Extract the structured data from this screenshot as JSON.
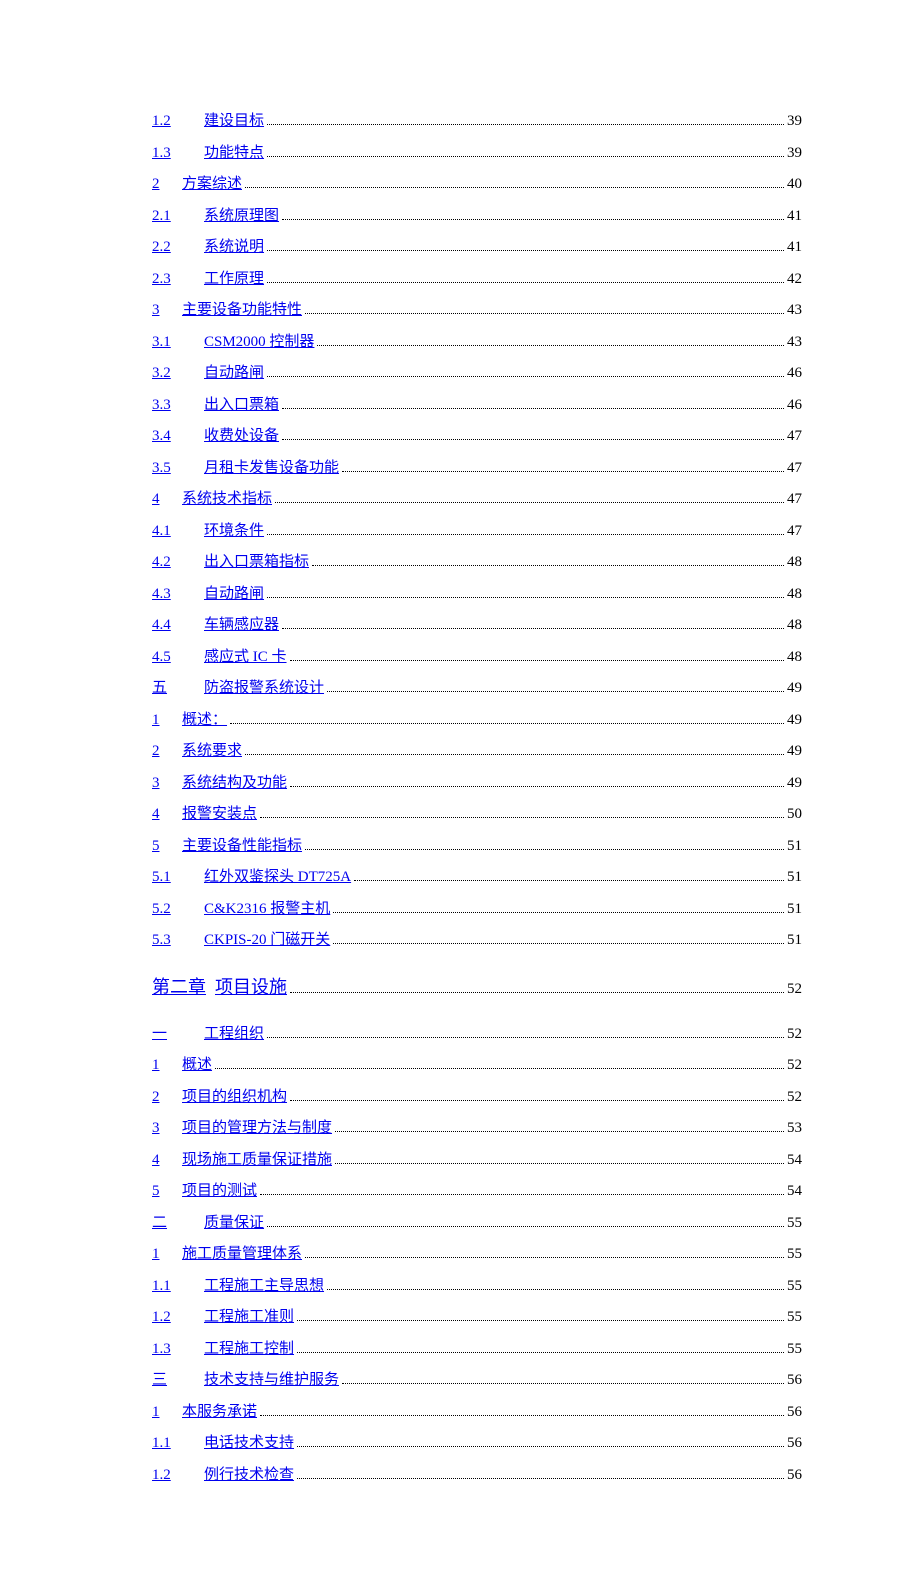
{
  "toc": [
    {
      "type": "item",
      "num": "1.2",
      "numW": 52,
      "title": "建设目标",
      "page": "39"
    },
    {
      "type": "item",
      "num": "1.3",
      "numW": 52,
      "title": "功能特点",
      "page": "39"
    },
    {
      "type": "item",
      "num": "2",
      "numW": 30,
      "title": "方案综述",
      "page": "40"
    },
    {
      "type": "item",
      "num": "2.1",
      "numW": 52,
      "title": "系统原理图",
      "page": "41"
    },
    {
      "type": "item",
      "num": "2.2",
      "numW": 52,
      "title": "系统说明",
      "page": "41"
    },
    {
      "type": "item",
      "num": "2.3",
      "numW": 52,
      "title": "工作原理",
      "page": "42"
    },
    {
      "type": "item",
      "num": "3",
      "numW": 30,
      "title": "主要设备功能特性",
      "page": "43"
    },
    {
      "type": "item",
      "num": "3.1",
      "numW": 52,
      "title": "CSM2000 控制器",
      "page": "43"
    },
    {
      "type": "item",
      "num": "3.2",
      "numW": 52,
      "title": "自动路闸",
      "page": "46"
    },
    {
      "type": "item",
      "num": "3.3",
      "numW": 52,
      "title": "出入口票箱",
      "page": "46"
    },
    {
      "type": "item",
      "num": "3.4",
      "numW": 52,
      "title": "收费处设备",
      "page": "47"
    },
    {
      "type": "item",
      "num": "3.5",
      "numW": 52,
      "title": "月租卡发售设备功能",
      "page": "47"
    },
    {
      "type": "item",
      "num": "4",
      "numW": 30,
      "title": "系统技术指标",
      "page": "47"
    },
    {
      "type": "item",
      "num": "4.1",
      "numW": 52,
      "title": "环境条件",
      "page": "47"
    },
    {
      "type": "item",
      "num": "4.2",
      "numW": 52,
      "title": "出入口票箱指标",
      "page": "48"
    },
    {
      "type": "item",
      "num": "4.3",
      "numW": 52,
      "title": "自动路闸",
      "page": "48"
    },
    {
      "type": "item",
      "num": "4.4",
      "numW": 52,
      "title": "车辆感应器",
      "page": "48"
    },
    {
      "type": "item",
      "num": "4.5",
      "numW": 52,
      "title": "感应式 IC 卡",
      "page": "48"
    },
    {
      "type": "item",
      "num": "五",
      "numW": 52,
      "title": "防盗报警系统设计",
      "page": "49"
    },
    {
      "type": "item",
      "num": "1",
      "numW": 30,
      "title": "概述：",
      "page": "49"
    },
    {
      "type": "item",
      "num": "2",
      "numW": 30,
      "title": "系统要求",
      "page": "49"
    },
    {
      "type": "item",
      "num": "3",
      "numW": 30,
      "title": "系统结构及功能",
      "page": "49"
    },
    {
      "type": "item",
      "num": "4",
      "numW": 30,
      "title": "报警安装点",
      "page": "50"
    },
    {
      "type": "item",
      "num": "5",
      "numW": 30,
      "title": "主要设备性能指标",
      "page": "51"
    },
    {
      "type": "item",
      "num": "5.1",
      "numW": 52,
      "title": "红外双鉴探头 DT725A",
      "page": "51"
    },
    {
      "type": "item",
      "num": "5.2",
      "numW": 52,
      "title": "C&K2316 报警主机",
      "page": "51"
    },
    {
      "type": "item",
      "num": "5.3",
      "numW": 52,
      "title": "CKPIS-20 门磁开关",
      "page": "51"
    },
    {
      "type": "chapter",
      "num": "第二章",
      "numW": 52,
      "title": "项目设施",
      "page": "52"
    },
    {
      "type": "item",
      "num": "一",
      "numW": 52,
      "title": "工程组织",
      "page": "52"
    },
    {
      "type": "item",
      "num": "1",
      "numW": 30,
      "title": "概述",
      "page": "52"
    },
    {
      "type": "item",
      "num": "2",
      "numW": 30,
      "title": "项目的组织机构",
      "page": "52"
    },
    {
      "type": "item",
      "num": "3",
      "numW": 30,
      "title": "项目的管理方法与制度",
      "page": "53"
    },
    {
      "type": "item",
      "num": "4",
      "numW": 30,
      "title": "现场施工质量保证措施",
      "page": "54"
    },
    {
      "type": "item",
      "num": "5",
      "numW": 30,
      "title": "项目的测试",
      "page": "54"
    },
    {
      "type": "item",
      "num": "二",
      "numW": 52,
      "title": "质量保证",
      "page": "55"
    },
    {
      "type": "item",
      "num": "1",
      "numW": 30,
      "title": "施工质量管理体系",
      "page": "55"
    },
    {
      "type": "item",
      "num": "1.1",
      "numW": 52,
      "title": "工程施工主导思想",
      "page": "55"
    },
    {
      "type": "item",
      "num": "1.2",
      "numW": 52,
      "title": "工程施工准则",
      "page": "55"
    },
    {
      "type": "item",
      "num": "1.3",
      "numW": 52,
      "title": "工程施工控制",
      "page": "55"
    },
    {
      "type": "item",
      "num": "三",
      "numW": 52,
      "title": "技术支持与维护服务",
      "page": "56"
    },
    {
      "type": "item",
      "num": "1",
      "numW": 30,
      "title": "本服务承诺",
      "page": "56"
    },
    {
      "type": "item",
      "num": "1.1",
      "numW": 52,
      "title": "电话技术支持",
      "page": "56"
    },
    {
      "type": "item",
      "num": "1.2",
      "numW": 52,
      "title": "例行技术检查",
      "page": "56"
    }
  ]
}
